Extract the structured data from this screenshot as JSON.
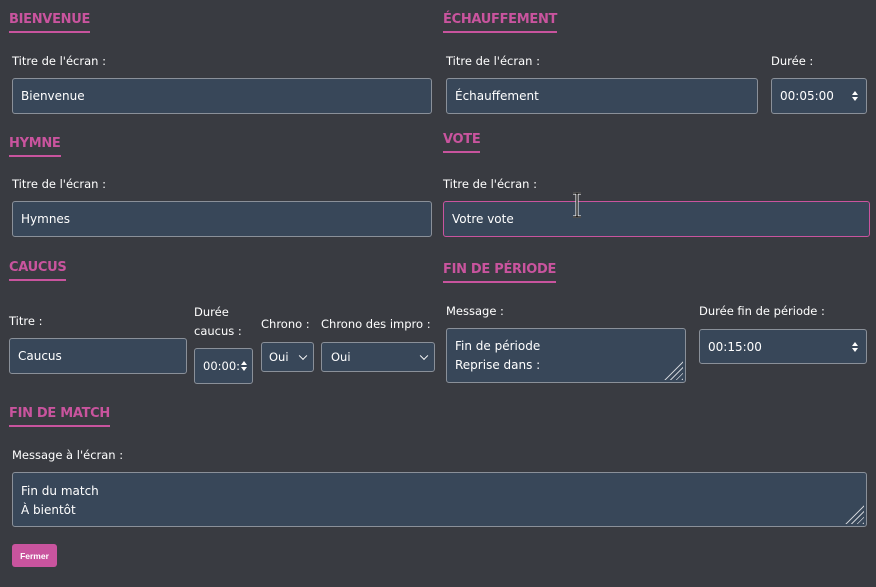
{
  "welcome": {
    "heading": "BIENVENUE",
    "title_label": "Titre de l'écran :",
    "title_value": "Bienvenue"
  },
  "warmup": {
    "heading": "ÉCHAUFFEMENT",
    "title_label": "Titre de l'écran :",
    "title_value": "Échauffement",
    "duration_label": "Durée :",
    "duration_value": "00:05:00"
  },
  "anthem": {
    "heading": "HYMNE",
    "title_label": "Titre de l'écran :",
    "title_value": "Hymnes"
  },
  "vote": {
    "heading": "VOTE",
    "title_label": "Titre de l'écran :",
    "title_value": "Votre vote"
  },
  "caucus": {
    "heading": "CAUCUS",
    "title_label": "Titre :",
    "title_value": "Caucus",
    "duration_label_line1": "Durée",
    "duration_label_line2": "caucus :",
    "duration_value": "00:00:",
    "chrono_label": "Chrono :",
    "chrono_value": "Oui",
    "chrono_impro_label": "Chrono des impro :",
    "chrono_impro_value": "Oui"
  },
  "period_end": {
    "heading": "FIN DE PÉRIODE",
    "message_label": "Message :",
    "message_lines": [
      "Fin de période",
      "Reprise dans :"
    ],
    "duration_label": "Durée fin de période :",
    "duration_value": "00:15:00"
  },
  "match_end": {
    "heading": "FIN DE MATCH",
    "message_label": "Message à l'écran :",
    "message_lines": [
      "Fin du match",
      "À bientôt"
    ]
  },
  "close_button": "Fermer",
  "colors": {
    "background": "#393b41",
    "accent": "#c9549e",
    "field_bg": "#384759"
  }
}
